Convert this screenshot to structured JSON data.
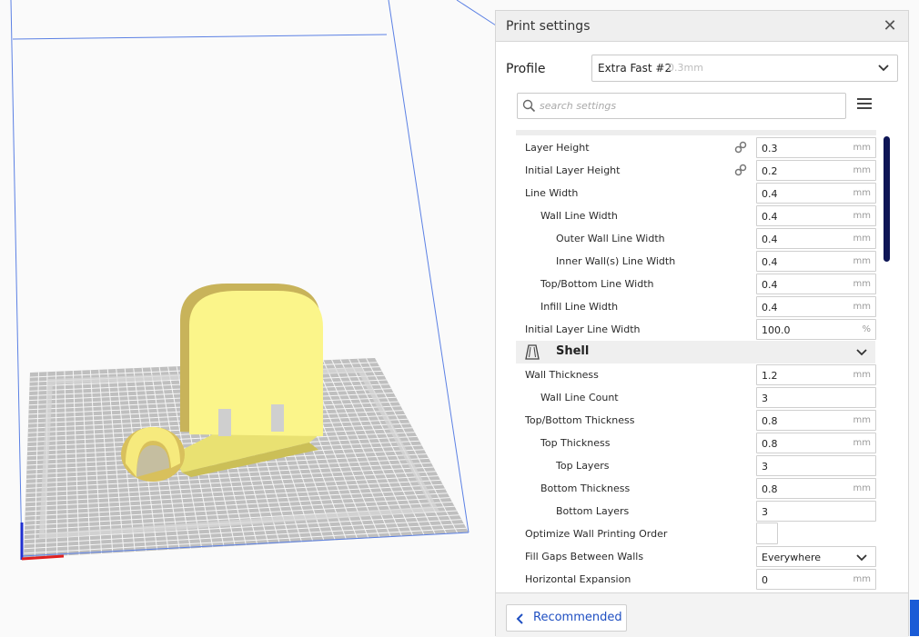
{
  "panel": {
    "title": "Print settings",
    "close_symbol": "✕",
    "profile_label": "Profile",
    "profile_name": "Extra Fast #2",
    "profile_layer": "0.3mm",
    "search_placeholder": "search settings",
    "footer_button": "Recommended"
  },
  "settings": {
    "layer_height": {
      "label": "Layer Height",
      "value": "0.3",
      "unit": "mm"
    },
    "initial_layer_height": {
      "label": "Initial Layer Height",
      "value": "0.2",
      "unit": "mm"
    },
    "line_width": {
      "label": "Line Width",
      "value": "0.4",
      "unit": "mm"
    },
    "wall_line_width": {
      "label": "Wall Line Width",
      "value": "0.4",
      "unit": "mm"
    },
    "outer_wall_line_width": {
      "label": "Outer Wall Line Width",
      "value": "0.4",
      "unit": "mm"
    },
    "inner_wall_line_width": {
      "label": "Inner Wall(s) Line Width",
      "value": "0.4",
      "unit": "mm"
    },
    "top_bottom_line_width": {
      "label": "Top/Bottom Line Width",
      "value": "0.4",
      "unit": "mm"
    },
    "infill_line_width": {
      "label": "Infill Line Width",
      "value": "0.4",
      "unit": "mm"
    },
    "initial_layer_line_width": {
      "label": "Initial Layer Line Width",
      "value": "100.0",
      "unit": "%"
    },
    "shell_category": {
      "label": "Shell"
    },
    "wall_thickness": {
      "label": "Wall Thickness",
      "value": "1.2",
      "unit": "mm"
    },
    "wall_line_count": {
      "label": "Wall Line Count",
      "value": "3"
    },
    "top_bottom_thickness": {
      "label": "Top/Bottom Thickness",
      "value": "0.8",
      "unit": "mm"
    },
    "top_thickness": {
      "label": "Top Thickness",
      "value": "0.8",
      "unit": "mm"
    },
    "top_layers": {
      "label": "Top Layers",
      "value": "3"
    },
    "bottom_thickness": {
      "label": "Bottom Thickness",
      "value": "0.8",
      "unit": "mm"
    },
    "bottom_layers": {
      "label": "Bottom Layers",
      "value": "3"
    },
    "optimize_wall_order": {
      "label": "Optimize Wall Printing Order",
      "checked": false
    },
    "fill_gaps": {
      "label": "Fill Gaps Between Walls",
      "value": "Everywhere"
    },
    "horizontal_expansion": {
      "label": "Horizontal Expansion",
      "value": "0",
      "unit": "mm"
    }
  },
  "icons": {
    "link": "link-icon",
    "search": "search-icon",
    "menu": "hamburger-menu-icon",
    "shell": "shell-category-icon",
    "chevron_down": "chevron-down-icon",
    "chevron_left": "chevron-left-icon"
  },
  "colors": {
    "model": "#f5ef7e",
    "model_shadow": "#c9b75a",
    "build_volume": "#3f6ee0",
    "scrollbar": "#0e1656",
    "accent": "#1f4fc2"
  }
}
